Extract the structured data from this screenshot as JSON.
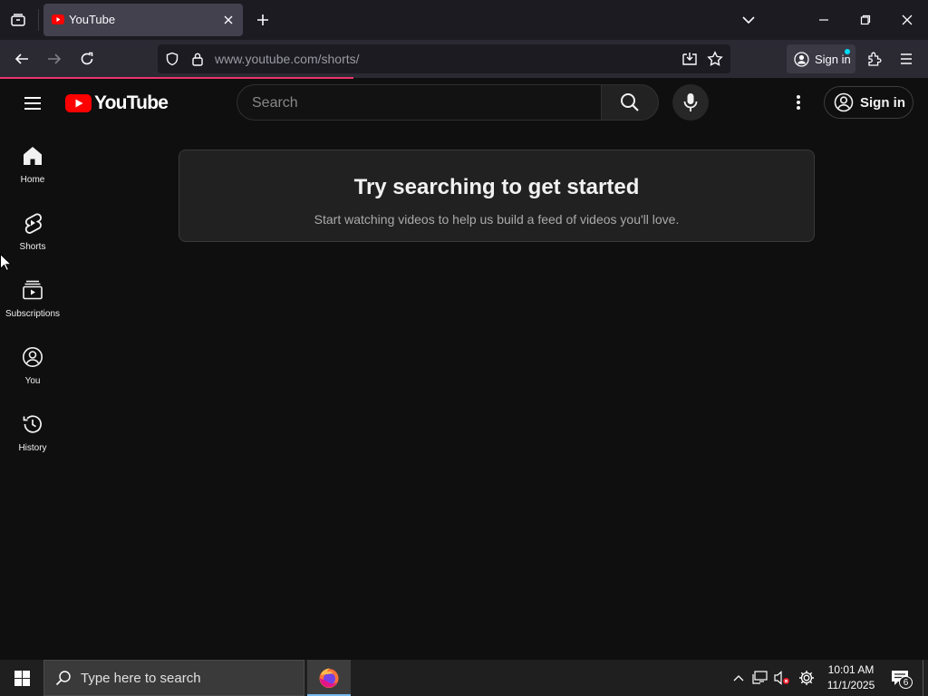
{
  "browser": {
    "tab": {
      "title": "YouTube"
    },
    "url": {
      "domain": "www.youtube.com",
      "path": "/shorts/"
    },
    "sign_in_label": "Sign in"
  },
  "youtube": {
    "brand": "YouTube",
    "search": {
      "placeholder": "Search"
    },
    "sign_in_label": "Sign in",
    "sidebar": [
      {
        "label": "Home",
        "icon": "home-icon"
      },
      {
        "label": "Shorts",
        "icon": "shorts-icon"
      },
      {
        "label": "Subscriptions",
        "icon": "subscriptions-icon"
      },
      {
        "label": "You",
        "icon": "you-icon"
      },
      {
        "label": "History",
        "icon": "history-icon"
      }
    ],
    "empty_state": {
      "title": "Try searching to get started",
      "subtitle": "Start watching videos to help us build a feed of videos you'll love."
    }
  },
  "taskbar": {
    "search_placeholder": "Type here to search",
    "time": "10:01 AM",
    "date": "11/1/2025",
    "notification_count": "6"
  },
  "colors": {
    "yt_red": "#ff0000",
    "background": "#0f0f0f",
    "card": "#212121",
    "loading_bar": "#e8366d"
  }
}
